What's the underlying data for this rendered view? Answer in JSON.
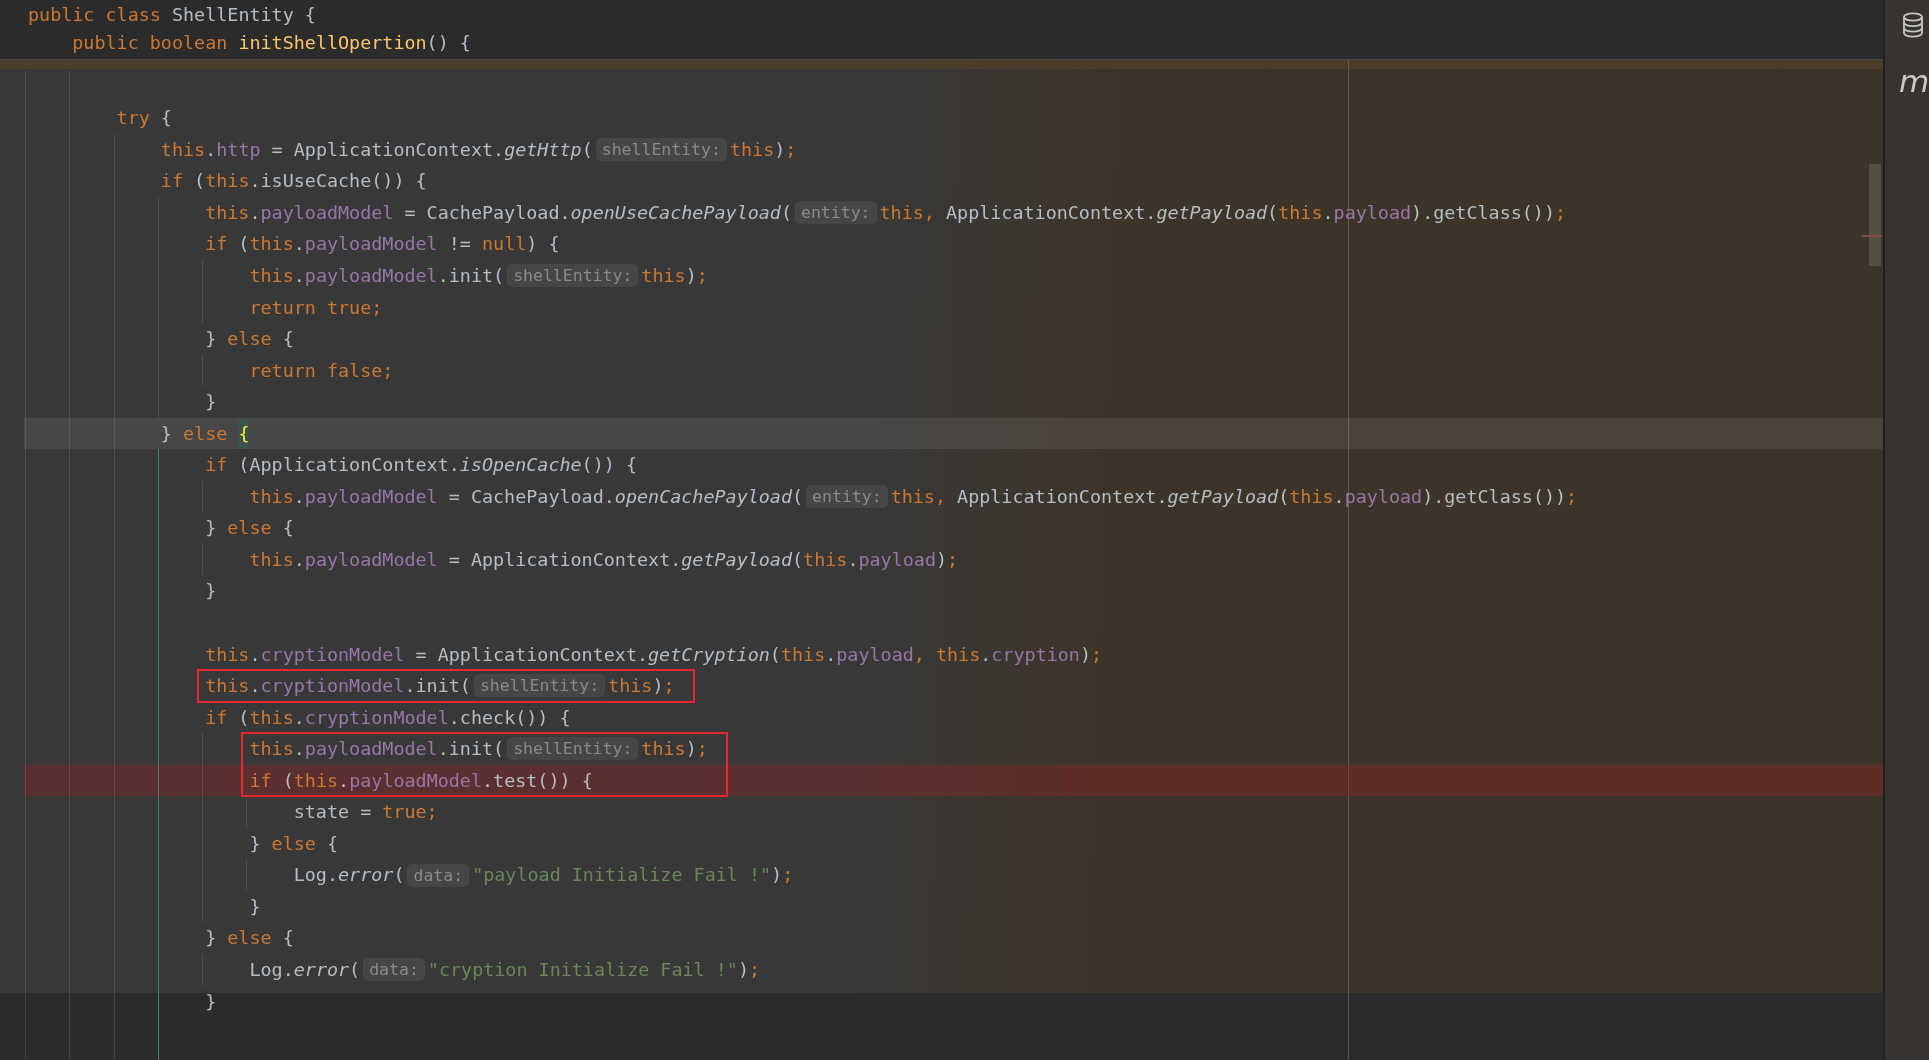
{
  "sticky_header": {
    "lines": [
      {
        "tokens": [
          {
            "kind": "keyword",
            "text": "public class"
          },
          {
            "kind": "plain",
            "text": " ShellEntity {"
          }
        ],
        "children": [
          {
            "tokens": [
              {
                "kind": "keyword",
                "text": "public boolean "
              },
              {
                "kind": "declaration",
                "text": "initShellOpertion"
              },
              {
                "kind": "plain",
                "text": "() {"
              }
            ]
          }
        ]
      }
    ]
  },
  "editor": {
    "lines": [
      {
        "kind": "blank",
        "current": false,
        "breakpoint": false,
        "boxed": false
      },
      {
        "kind": "code",
        "tokens": [
          {
            "kind": "keyword",
            "text": "try"
          },
          {
            "kind": "plain",
            "text": " {"
          }
        ],
        "current": false,
        "breakpoint": false,
        "boxed": false,
        "children": [
          {
            "kind": "code",
            "tokens": [
              {
                "kind": "keyword",
                "text": "this"
              },
              {
                "kind": "plain",
                "text": "."
              },
              {
                "kind": "field",
                "text": "http"
              },
              {
                "kind": "plain",
                "text": " = ApplicationContext."
              },
              {
                "kind": "static",
                "text": "getHttp"
              },
              {
                "kind": "plain",
                "text": "("
              },
              {
                "kind": "hint",
                "text": "shellEntity:"
              },
              {
                "kind": "keyword",
                "text": "this"
              },
              {
                "kind": "plain",
                "text": ")"
              },
              {
                "kind": "punct",
                "text": ";"
              }
            ],
            "current": false,
            "breakpoint": false,
            "boxed": false
          },
          {
            "kind": "code",
            "tokens": [
              {
                "kind": "keyword",
                "text": "if"
              },
              {
                "kind": "plain",
                "text": " ("
              },
              {
                "kind": "keyword",
                "text": "this"
              },
              {
                "kind": "plain",
                "text": ".isUseCache()) {"
              }
            ],
            "current": false,
            "breakpoint": false,
            "boxed": false,
            "children": [
              {
                "kind": "code",
                "tokens": [
                  {
                    "kind": "keyword",
                    "text": "this"
                  },
                  {
                    "kind": "plain",
                    "text": "."
                  },
                  {
                    "kind": "field",
                    "text": "payloadModel"
                  },
                  {
                    "kind": "plain",
                    "text": " = CachePayload."
                  },
                  {
                    "kind": "static",
                    "text": "openUseCachePayload"
                  },
                  {
                    "kind": "plain",
                    "text": "("
                  },
                  {
                    "kind": "hint",
                    "text": "entity:"
                  },
                  {
                    "kind": "keyword",
                    "text": "this"
                  },
                  {
                    "kind": "punct",
                    "text": ", "
                  },
                  {
                    "kind": "plain",
                    "text": "ApplicationContext."
                  },
                  {
                    "kind": "static",
                    "text": "getPayload"
                  },
                  {
                    "kind": "plain",
                    "text": "("
                  },
                  {
                    "kind": "keyword",
                    "text": "this"
                  },
                  {
                    "kind": "plain",
                    "text": "."
                  },
                  {
                    "kind": "field",
                    "text": "payload"
                  },
                  {
                    "kind": "plain",
                    "text": ").getClass())"
                  },
                  {
                    "kind": "punct",
                    "text": ";"
                  }
                ],
                "current": false,
                "breakpoint": false,
                "boxed": false
              },
              {
                "kind": "code",
                "tokens": [
                  {
                    "kind": "keyword",
                    "text": "if"
                  },
                  {
                    "kind": "plain",
                    "text": " ("
                  },
                  {
                    "kind": "keyword",
                    "text": "this"
                  },
                  {
                    "kind": "plain",
                    "text": "."
                  },
                  {
                    "kind": "field",
                    "text": "payloadModel"
                  },
                  {
                    "kind": "plain",
                    "text": " != "
                  },
                  {
                    "kind": "keyword",
                    "text": "null"
                  },
                  {
                    "kind": "plain",
                    "text": ") {"
                  }
                ],
                "current": false,
                "breakpoint": false,
                "boxed": false,
                "children": [
                  {
                    "kind": "code",
                    "tokens": [
                      {
                        "kind": "keyword",
                        "text": "this"
                      },
                      {
                        "kind": "plain",
                        "text": "."
                      },
                      {
                        "kind": "field",
                        "text": "payloadModel"
                      },
                      {
                        "kind": "plain",
                        "text": ".init("
                      },
                      {
                        "kind": "hint",
                        "text": "shellEntity:"
                      },
                      {
                        "kind": "keyword",
                        "text": "this"
                      },
                      {
                        "kind": "plain",
                        "text": ")"
                      },
                      {
                        "kind": "punct",
                        "text": ";"
                      }
                    ],
                    "current": false,
                    "breakpoint": false,
                    "boxed": false
                  },
                  {
                    "kind": "code",
                    "tokens": [
                      {
                        "kind": "keyword",
                        "text": "return true"
                      },
                      {
                        "kind": "punct",
                        "text": ";"
                      }
                    ],
                    "current": false,
                    "breakpoint": false,
                    "boxed": false
                  }
                ]
              },
              {
                "kind": "code",
                "tokens": [
                  {
                    "kind": "plain",
                    "text": "} "
                  },
                  {
                    "kind": "keyword",
                    "text": "else"
                  },
                  {
                    "kind": "plain",
                    "text": " {"
                  }
                ],
                "current": false,
                "breakpoint": false,
                "boxed": false,
                "children": [
                  {
                    "kind": "code",
                    "tokens": [
                      {
                        "kind": "keyword",
                        "text": "return false"
                      },
                      {
                        "kind": "punct",
                        "text": ";"
                      }
                    ],
                    "current": false,
                    "breakpoint": false,
                    "boxed": false
                  }
                ]
              },
              {
                "kind": "code",
                "tokens": [
                  {
                    "kind": "plain",
                    "text": "}"
                  }
                ],
                "current": false,
                "breakpoint": false,
                "boxed": false
              }
            ]
          },
          {
            "kind": "code",
            "tokens": [
              {
                "kind": "plain",
                "text": "} "
              },
              {
                "kind": "keyword",
                "text": "else "
              },
              {
                "kind": "brace",
                "text": "{"
              }
            ],
            "current": true,
            "breakpoint": false,
            "boxed": false,
            "children": [
              {
                "kind": "code",
                "tokens": [
                  {
                    "kind": "keyword",
                    "text": "if"
                  },
                  {
                    "kind": "plain",
                    "text": " (ApplicationContext."
                  },
                  {
                    "kind": "static",
                    "text": "isOpenCache"
                  },
                  {
                    "kind": "plain",
                    "text": "()) {"
                  }
                ],
                "current": false,
                "breakpoint": false,
                "boxed": false,
                "children": [
                  {
                    "kind": "code",
                    "tokens": [
                      {
                        "kind": "keyword",
                        "text": "this"
                      },
                      {
                        "kind": "plain",
                        "text": "."
                      },
                      {
                        "kind": "field",
                        "text": "payloadModel"
                      },
                      {
                        "kind": "plain",
                        "text": " = CachePayload."
                      },
                      {
                        "kind": "static",
                        "text": "openCachePayload"
                      },
                      {
                        "kind": "plain",
                        "text": "("
                      },
                      {
                        "kind": "hint",
                        "text": "entity:"
                      },
                      {
                        "kind": "keyword",
                        "text": "this"
                      },
                      {
                        "kind": "punct",
                        "text": ", "
                      },
                      {
                        "kind": "plain",
                        "text": "ApplicationContext."
                      },
                      {
                        "kind": "static",
                        "text": "getPayload"
                      },
                      {
                        "kind": "plain",
                        "text": "("
                      },
                      {
                        "kind": "keyword",
                        "text": "this"
                      },
                      {
                        "kind": "plain",
                        "text": "."
                      },
                      {
                        "kind": "field",
                        "text": "payload"
                      },
                      {
                        "kind": "plain",
                        "text": ").getClass())"
                      },
                      {
                        "kind": "punct",
                        "text": ";"
                      }
                    ],
                    "current": false,
                    "breakpoint": false,
                    "boxed": false
                  }
                ]
              },
              {
                "kind": "code",
                "tokens": [
                  {
                    "kind": "plain",
                    "text": "} "
                  },
                  {
                    "kind": "keyword",
                    "text": "else"
                  },
                  {
                    "kind": "plain",
                    "text": " {"
                  }
                ],
                "current": false,
                "breakpoint": false,
                "boxed": false,
                "children": [
                  {
                    "kind": "code",
                    "tokens": [
                      {
                        "kind": "keyword",
                        "text": "this"
                      },
                      {
                        "kind": "plain",
                        "text": "."
                      },
                      {
                        "kind": "field",
                        "text": "payloadModel"
                      },
                      {
                        "kind": "plain",
                        "text": " = ApplicationContext."
                      },
                      {
                        "kind": "static",
                        "text": "getPayload"
                      },
                      {
                        "kind": "plain",
                        "text": "("
                      },
                      {
                        "kind": "keyword",
                        "text": "this"
                      },
                      {
                        "kind": "plain",
                        "text": "."
                      },
                      {
                        "kind": "field",
                        "text": "payload"
                      },
                      {
                        "kind": "plain",
                        "text": ")"
                      },
                      {
                        "kind": "punct",
                        "text": ";"
                      }
                    ],
                    "current": false,
                    "breakpoint": false,
                    "boxed": false
                  }
                ]
              },
              {
                "kind": "code",
                "tokens": [
                  {
                    "kind": "plain",
                    "text": "}"
                  }
                ],
                "current": false,
                "breakpoint": false,
                "boxed": false
              },
              {
                "kind": "blank",
                "current": false,
                "breakpoint": false,
                "boxed": false
              },
              {
                "kind": "code",
                "tokens": [
                  {
                    "kind": "keyword",
                    "text": "this"
                  },
                  {
                    "kind": "plain",
                    "text": "."
                  },
                  {
                    "kind": "field",
                    "text": "cryptionModel"
                  },
                  {
                    "kind": "plain",
                    "text": " = ApplicationContext."
                  },
                  {
                    "kind": "static",
                    "text": "getCryption"
                  },
                  {
                    "kind": "plain",
                    "text": "("
                  },
                  {
                    "kind": "keyword",
                    "text": "this"
                  },
                  {
                    "kind": "plain",
                    "text": "."
                  },
                  {
                    "kind": "field",
                    "text": "payload"
                  },
                  {
                    "kind": "punct",
                    "text": ", "
                  },
                  {
                    "kind": "keyword",
                    "text": "this"
                  },
                  {
                    "kind": "plain",
                    "text": "."
                  },
                  {
                    "kind": "field",
                    "text": "cryption"
                  },
                  {
                    "kind": "plain",
                    "text": ")"
                  },
                  {
                    "kind": "punct",
                    "text": ";"
                  }
                ],
                "current": false,
                "breakpoint": false,
                "boxed": false
              },
              {
                "kind": "code",
                "tokens": [
                  {
                    "kind": "keyword",
                    "text": "this"
                  },
                  {
                    "kind": "plain",
                    "text": "."
                  },
                  {
                    "kind": "field",
                    "text": "cryptionModel"
                  },
                  {
                    "kind": "plain",
                    "text": ".init("
                  },
                  {
                    "kind": "hint",
                    "text": "shellEntity:"
                  },
                  {
                    "kind": "keyword",
                    "text": "this"
                  },
                  {
                    "kind": "plain",
                    "text": ")"
                  },
                  {
                    "kind": "punct",
                    "text": ";"
                  }
                ],
                "current": false,
                "breakpoint": false,
                "boxed": true
              },
              {
                "kind": "code",
                "tokens": [
                  {
                    "kind": "keyword",
                    "text": "if"
                  },
                  {
                    "kind": "plain",
                    "text": " ("
                  },
                  {
                    "kind": "keyword",
                    "text": "this"
                  },
                  {
                    "kind": "plain",
                    "text": "."
                  },
                  {
                    "kind": "field",
                    "text": "cryptionModel"
                  },
                  {
                    "kind": "plain",
                    "text": ".check()) {"
                  }
                ],
                "current": false,
                "breakpoint": false,
                "boxed": false,
                "children": [
                  {
                    "kind": "code",
                    "tokens": [
                      {
                        "kind": "keyword",
                        "text": "this"
                      },
                      {
                        "kind": "plain",
                        "text": "."
                      },
                      {
                        "kind": "field",
                        "text": "payloadModel"
                      },
                      {
                        "kind": "plain",
                        "text": ".init("
                      },
                      {
                        "kind": "hint",
                        "text": "shellEntity:"
                      },
                      {
                        "kind": "keyword",
                        "text": "this"
                      },
                      {
                        "kind": "plain",
                        "text": ")"
                      },
                      {
                        "kind": "punct",
                        "text": ";"
                      }
                    ],
                    "current": false,
                    "breakpoint": false,
                    "boxed": true
                  },
                  {
                    "kind": "code",
                    "tokens": [
                      {
                        "kind": "keyword",
                        "text": "if"
                      },
                      {
                        "kind": "plain",
                        "text": " ("
                      },
                      {
                        "kind": "keyword",
                        "text": "this"
                      },
                      {
                        "kind": "plain",
                        "text": "."
                      },
                      {
                        "kind": "field",
                        "text": "payloadModel"
                      },
                      {
                        "kind": "plain",
                        "text": ".test()) {"
                      }
                    ],
                    "current": false,
                    "breakpoint": true,
                    "boxed": true,
                    "children": [
                      {
                        "kind": "code",
                        "tokens": [
                          {
                            "kind": "plain",
                            "text": "state = "
                          },
                          {
                            "kind": "keyword",
                            "text": "true"
                          },
                          {
                            "kind": "punct",
                            "text": ";"
                          }
                        ],
                        "current": false,
                        "breakpoint": false,
                        "boxed": false
                      }
                    ]
                  },
                  {
                    "kind": "code",
                    "tokens": [
                      {
                        "kind": "plain",
                        "text": "} "
                      },
                      {
                        "kind": "keyword",
                        "text": "else"
                      },
                      {
                        "kind": "plain",
                        "text": " {"
                      }
                    ],
                    "current": false,
                    "breakpoint": false,
                    "boxed": false,
                    "children": [
                      {
                        "kind": "code",
                        "tokens": [
                          {
                            "kind": "plain",
                            "text": "Log."
                          },
                          {
                            "kind": "static",
                            "text": "error"
                          },
                          {
                            "kind": "plain",
                            "text": "("
                          },
                          {
                            "kind": "hint",
                            "text": "data:"
                          },
                          {
                            "kind": "string",
                            "text": "\"payload Initialize Fail !\""
                          },
                          {
                            "kind": "plain",
                            "text": ")"
                          },
                          {
                            "kind": "punct",
                            "text": ";"
                          }
                        ],
                        "current": false,
                        "breakpoint": false,
                        "boxed": false
                      }
                    ]
                  },
                  {
                    "kind": "code",
                    "tokens": [
                      {
                        "kind": "plain",
                        "text": "}"
                      }
                    ],
                    "current": false,
                    "breakpoint": false,
                    "boxed": false
                  }
                ]
              },
              {
                "kind": "code",
                "tokens": [
                  {
                    "kind": "plain",
                    "text": "} "
                  },
                  {
                    "kind": "keyword",
                    "text": "else"
                  },
                  {
                    "kind": "plain",
                    "text": " {"
                  }
                ],
                "current": false,
                "breakpoint": false,
                "boxed": false,
                "children": [
                  {
                    "kind": "code",
                    "tokens": [
                      {
                        "kind": "plain",
                        "text": "Log."
                      },
                      {
                        "kind": "static",
                        "text": "error"
                      },
                      {
                        "kind": "plain",
                        "text": "("
                      },
                      {
                        "kind": "hint",
                        "text": "data:"
                      },
                      {
                        "kind": "string",
                        "text": "\"cryption Initialize Fail !\""
                      },
                      {
                        "kind": "plain",
                        "text": ")"
                      },
                      {
                        "kind": "punct",
                        "text": ";"
                      }
                    ],
                    "current": false,
                    "breakpoint": false,
                    "boxed": false
                  }
                ]
              },
              {
                "kind": "code",
                "tokens": [
                  {
                    "kind": "plain",
                    "text": "}"
                  }
                ],
                "current": false,
                "breakpoint": false,
                "boxed": false
              },
              {
                "kind": "blank",
                "current": false,
                "breakpoint": false,
                "boxed": false
              }
            ]
          }
        ]
      }
    ]
  },
  "tool_strip": {
    "buttons": [
      {
        "kind": "database"
      },
      {
        "kind": "glyph",
        "text": "m"
      }
    ]
  }
}
